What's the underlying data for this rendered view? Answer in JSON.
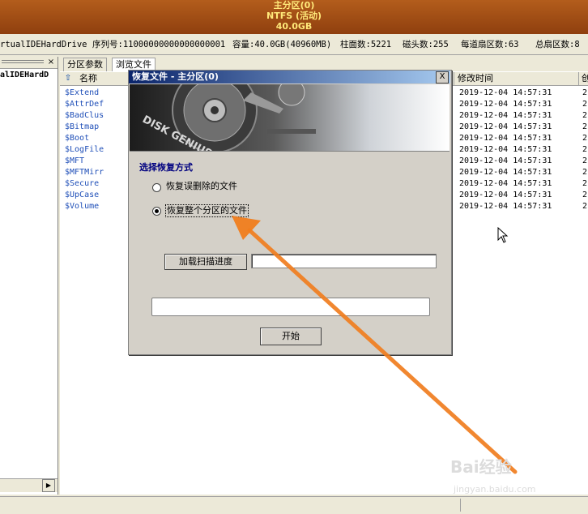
{
  "banner": {
    "line1": "主分区(0)",
    "line2": "NTFS (活动)",
    "line3": "40.0GB"
  },
  "diskbar": {
    "drive": "rtualIDEHardDrive",
    "serial": "序列号:11000000000000000001",
    "capacity": "容量:40.0GB(40960MB)",
    "cylinders": "柱面数:5221",
    "heads": "磁头数:255",
    "sectors_per_track": "每道扇区数:63",
    "total_sectors": "总扇区数:8"
  },
  "left_panel": {
    "close_glyph": "×",
    "item": "alIDEHardD"
  },
  "tabs": {
    "partition_params": "分区参数",
    "browse_files": "浏览文件"
  },
  "columns": {
    "name": "名称",
    "modified": "修改时间",
    "cut": "创"
  },
  "files": [
    "$Extend",
    "$AttrDef",
    "$BadClus",
    "$Bitmap",
    "$Boot",
    "$LogFile",
    "$MFT",
    "$MFTMirr",
    "$Secure",
    "$UpCase",
    "$Volume"
  ],
  "modified_times": [
    "2019-12-04 14:57:31",
    "2019-12-04 14:57:31",
    "2019-12-04 14:57:31",
    "2019-12-04 14:57:31",
    "2019-12-04 14:57:31",
    "2019-12-04 14:57:31",
    "2019-12-04 14:57:31",
    "2019-12-04 14:57:31",
    "2019-12-04 14:57:31",
    "2019-12-04 14:57:31",
    "2019-12-04 14:57:31"
  ],
  "cut_values": [
    "2",
    "2",
    "2",
    "2",
    "2",
    "2",
    "2",
    "2",
    "2",
    "2",
    "2"
  ],
  "dialog": {
    "title": "恢复文件 - 主分区(0)",
    "close_glyph": "X",
    "banner_text": "DISK GENIUS",
    "section": "选择恢复方式",
    "option1": "恢复误删除的文件",
    "option2": "恢复整个分区的文件",
    "selected_option": 2,
    "load_button": "加载扫描进度",
    "load_path": "",
    "start_button": "开始"
  },
  "watermark": {
    "brand": "Bai经验",
    "url": "jingyan.baidu.com"
  },
  "colors": {
    "banner": "#8f3f0e",
    "banner_text": "#ffe97a",
    "file_text": "#1f4fb8",
    "dialog_title": "#0a246a",
    "annotation_arrow": "#f07d1e"
  }
}
